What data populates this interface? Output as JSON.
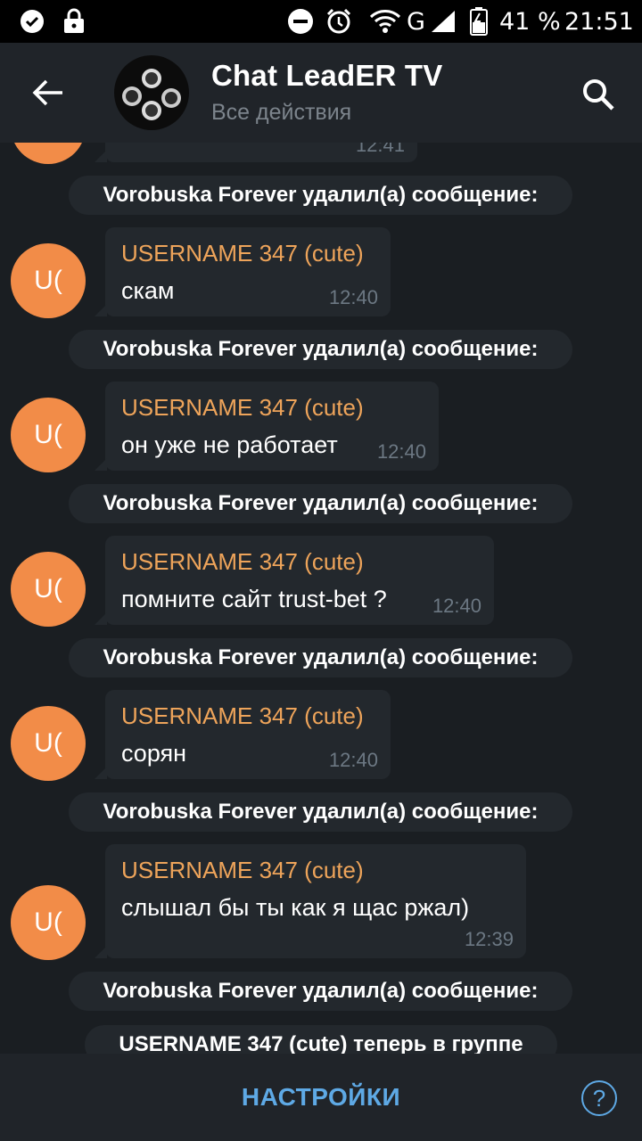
{
  "status_bar": {
    "battery_percent": "41 %",
    "time": "21:51",
    "network": "G",
    "left_icons": [
      "check-circle-icon",
      "lock-icon"
    ],
    "right_icons": [
      "dnd-icon",
      "alarm-icon",
      "wifi-icon",
      "signal-icon",
      "battery-icon"
    ]
  },
  "header": {
    "title": "Chat LeadER TV",
    "subtitle": "Все действия"
  },
  "chat": {
    "top_partial_time": "12:41",
    "service_message": "Vorobuska Forever удалил(а) сообщение:",
    "messages": [
      {
        "avatar": "U(",
        "author": "USERNAME 347 (cute)",
        "text": "скам",
        "time": "12:40"
      },
      {
        "avatar": "U(",
        "author": "USERNAME 347 (cute)",
        "text": "он уже не работает",
        "time": "12:40"
      },
      {
        "avatar": "U(",
        "author": "USERNAME 347 (cute)",
        "text": "помните сайт trust-bet ?",
        "time": "12:40"
      },
      {
        "avatar": "U(",
        "author": "USERNAME 347 (cute)",
        "text": "сорян",
        "time": "12:40"
      },
      {
        "avatar": "U(",
        "author": "USERNAME 347 (cute)",
        "text": "слышал бы ты как я щас ржал)",
        "time": "12:39"
      }
    ],
    "bottom_service": "USERNAME 347 (cute) теперь в группе"
  },
  "bottom_bar": {
    "settings_label": "НАСТРОЙКИ",
    "help_label": "?"
  },
  "colors": {
    "accent": "#5ea9e5",
    "author": "#eea45a",
    "avatar": "#f28c48",
    "background": "#1a1e22",
    "bubble": "#23282d"
  }
}
